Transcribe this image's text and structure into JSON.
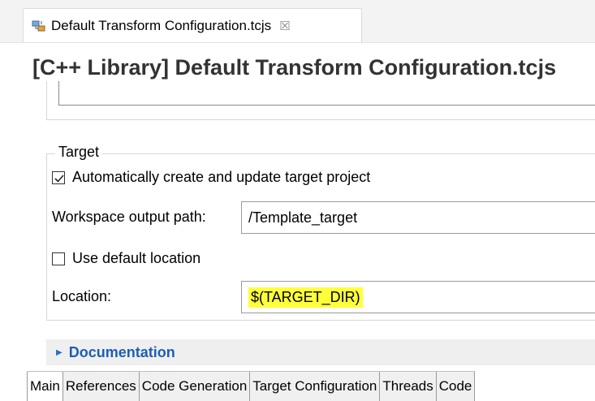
{
  "editor_tab": {
    "title": "Default Transform Configuration.tcjs",
    "close_glyph": "☒",
    "icon": "transform-config-file-icon"
  },
  "header": {
    "title": "[C++ Library] Default Transform Configuration.tcjs"
  },
  "target": {
    "legend": "Target",
    "auto_create_label": "Automatically create and update target project",
    "auto_create_checked": true,
    "workspace_output_label": "Workspace output path:",
    "workspace_output_value": "/Template_target",
    "use_default_location_label": "Use default location",
    "use_default_location_checked": false,
    "location_label": "Location:",
    "location_value": "$(TARGET_DIR)",
    "location_highlight_color": "#ffff3a"
  },
  "documentation": {
    "label": "Documentation",
    "arrow_glyph": "▶"
  },
  "bottom_tabs": [
    {
      "label": "Main",
      "active": true
    },
    {
      "label": "References",
      "active": false
    },
    {
      "label": "Code Generation",
      "active": false
    },
    {
      "label": "Target Configuration",
      "active": false
    },
    {
      "label": "Threads",
      "active": false
    },
    {
      "label": "Code",
      "active": false
    }
  ],
  "colors": {
    "link_blue": "#1d5fb3",
    "section_bg": "#efefef"
  }
}
